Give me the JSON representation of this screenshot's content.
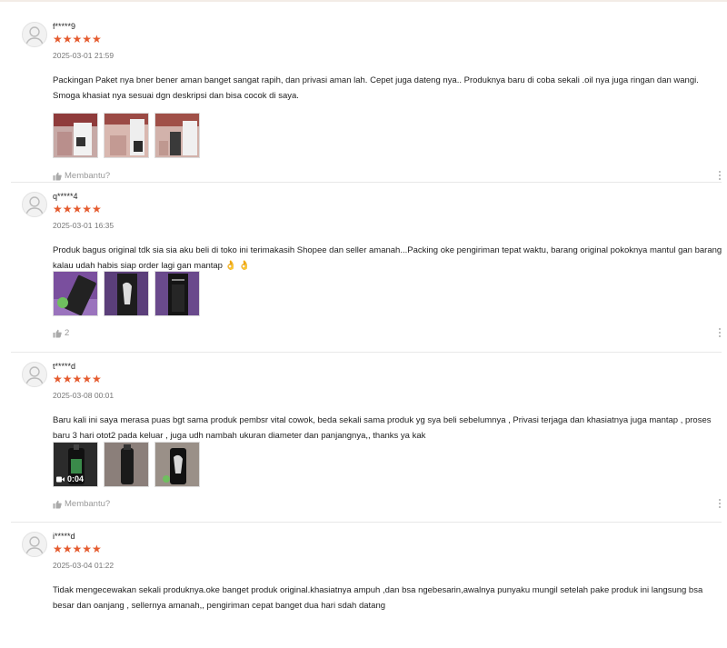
{
  "reviews": [
    {
      "username": "f*****9",
      "stars": "★★★★★",
      "date": "2025-03-01 21:59",
      "text": "Packingan Paket nya bner bener aman banget sangat rapih, dan privasi aman lah. Cepet juga dateng nya.. Produknya baru di coba sekali .oil nya juga ringan dan wangi. Smoga khasiat nya sesuai dgn deskripsi dan bisa cocok di saya.",
      "helpful": "Membantu?"
    },
    {
      "username": "q*****4",
      "stars": "★★★★★",
      "date": "2025-03-01 16:35",
      "text": "Produk bagus original tdk sia sia aku beli di toko ini terimakasih Shopee dan seller amanah...Packing oke pengiriman tepat waktu, barang original pokoknya mantul gan barang kalau udah habis siap order lagi gan mantap",
      "emoji": "👌 👌",
      "helpful": "2"
    },
    {
      "username": "t*****d",
      "stars": "★★★★★",
      "date": "2025-03-08 00:01",
      "text": "Baru kali ini saya merasa puas bgt sama produk pembsr vital cowok, beda sekali sama produk yg sya beli sebelumnya , Privasi terjaga dan khasiatnya juga mantap , proses baru 3 hari otot2 pada keluar , juga udh nambah ukuran diameter dan panjangnya,, thanks ya kak",
      "video_duration": "0:04",
      "helpful": "Membantu?"
    },
    {
      "username": "i*****d",
      "stars": "★★★★★",
      "date": "2025-03-04 01:22",
      "text": "Tidak mengecewakan sekali produknya.oke banget produk original.khasiatnya ampuh ,dan bsa ngebesarin,awalnya punyaku mungil setelah pake produk ini langsung bsa besar dan oanjang , sellernya amanah,, pengiriman cepat banget dua hari sdah datang"
    }
  ],
  "colors": {
    "star": "#e55b2f",
    "muted": "#999999"
  }
}
